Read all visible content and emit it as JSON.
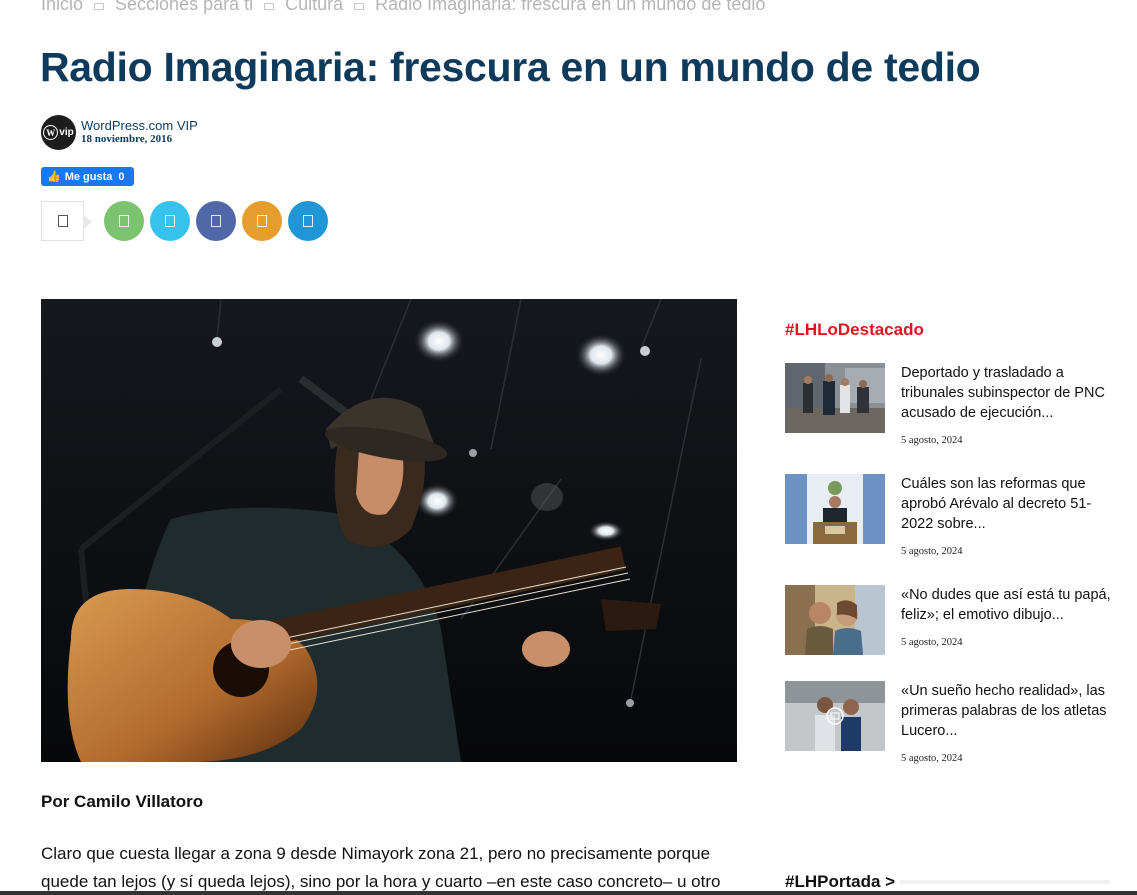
{
  "breadcrumb": {
    "items": [
      "Inicio",
      "Secciones para ti",
      "Cultura",
      "Radio Imaginaria: frescura en un mundo de tedio"
    ]
  },
  "article": {
    "title": "Radio Imaginaria: frescura en un mundo de tedio",
    "author": "WordPress.com VIP",
    "avatar_text": "vip",
    "date": "18 noviembre, 2016",
    "byline": "Por Camilo Villatoro",
    "body": "Claro que cuesta llegar a zona 9 desde Nimayork zona 21, pero no precisamente porque quede tan lejos (y sí queda lejos), sino por la hora y cuarto –en este caso concreto– u otro"
  },
  "like_button": {
    "label": "Me gusta",
    "count": "0"
  },
  "share": {
    "icons": [
      {
        "name": "share-count-icon",
        "color": "#ffffff"
      },
      {
        "name": "share-icon",
        "color": "#7cc36f"
      },
      {
        "name": "twitter-icon",
        "color": "#35c3ee"
      },
      {
        "name": "facebook-icon",
        "color": "#5168a8"
      },
      {
        "name": "email-icon",
        "color": "#e59e2d"
      },
      {
        "name": "telegram-icon",
        "color": "#2196d6"
      }
    ]
  },
  "sidebar": {
    "heading": "#LHLoDestacado",
    "items": [
      {
        "title": "Deportado y trasladado a tribunales subinspector de PNC acusado de ejecución...",
        "date": "5 agosto, 2024"
      },
      {
        "title": "Cuáles son las reformas que aprobó Arévalo al decreto 51-2022 sobre...",
        "date": "5 agosto, 2024"
      },
      {
        "title": "«No dudes que así está tu papá, feliz»; el emotivo dibujo...",
        "date": "5 agosto, 2024"
      },
      {
        "title": "«Un sueño hecho realidad», las primeras palabras de los atletas Lucero...",
        "date": "5 agosto, 2024"
      }
    ],
    "heading_2": "#LHPortada >"
  },
  "colors": {
    "title": "#0e3a5c",
    "accent_red": "#e0141e",
    "facebook_blue": "#1877f2"
  }
}
